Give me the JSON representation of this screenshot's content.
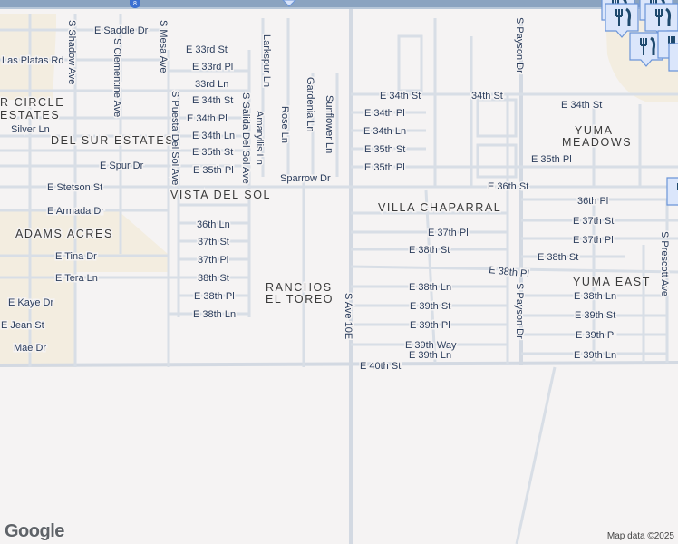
{
  "highway": {
    "shield": "8"
  },
  "neighborhoods": {
    "circle_estates_1": "R CIRCLE",
    "circle_estates_2": "ESTATES",
    "del_sur": "DEL SUR ESTATES",
    "vista": "VISTA DEL SOL",
    "adams": "ADAMS ACRES",
    "ranchos_1": "RANCHOS",
    "ranchos_2": "EL TOREO",
    "villa": "VILLA CHAPARRAL",
    "yuma_meadows_1": "YUMA",
    "yuma_meadows_2": "MEADOWS",
    "yuma_east": "YUMA EAST"
  },
  "streets": {
    "saddle": "E Saddle Dr",
    "las_platas": "Las Platas Rd",
    "shadow": "S Shadow Ave",
    "clementine": "S Clementine Ave",
    "mesa": "S Mesa Ave",
    "e33st": "E 33rd St",
    "e33pl": "E 33rd Pl",
    "ln33": "33rd Ln",
    "e34st_w": "E 34th St",
    "e34pl_w": "E 34th Pl",
    "e34ln_w": "E 34th Ln",
    "e35st_w": "E 35th St",
    "e35pl_w": "E 35th Pl",
    "silver": "Silver Ln",
    "spur": "E Spur Dr",
    "puesta": "S Puesta Del Sol Ave",
    "salida": "S Salida Del Sol Ave",
    "larkspur": "Larkspur Ln",
    "amaryllis": "Amaryllis Ln",
    "rose": "Rose Ln",
    "gardenia": "Gardenia Ln",
    "sunflower": "Sunflower Ln",
    "sparrow": "Sparrow Dr",
    "stetson": "E Stetson St",
    "armada": "E Armada Dr",
    "ln36": "36th Ln",
    "st37": "37th St",
    "pl37": "37th Pl",
    "st38": "38th St",
    "e38pl_w": "E 38th Pl",
    "e38ln_w": "E 38th Ln",
    "tina": "E Tina Dr",
    "tera": "E Tera Ln",
    "kaye": "E Kaye Dr",
    "jean": "E Jean St",
    "mae": "Mae Dr",
    "e34st_c": "E 34th St",
    "e34pl_c": "E 34th Pl",
    "e34ln_c": "E 34th Ln",
    "e35st_c": "E 35th St",
    "e35pl_c": "E 35th Pl",
    "st34": "34th St",
    "payson_n": "S Payson Dr",
    "e34st_e": "E 34th St",
    "e35pl_e": "E 35th Pl",
    "e36st": "E 36th St",
    "pl36": "36th Pl",
    "e37st": "E 37th St",
    "e37pl_c": "E 37th Pl",
    "e37pl_e": "E 37th Pl",
    "e38st_c": "E 38th St",
    "e38st_e": "E 38th St",
    "e38pl": "E 38th Pl",
    "e38ln_c": "E 38th Ln",
    "e38ln_e": "E 38th Ln",
    "e39st_c": "E 39th St",
    "e39st_e": "E 39th St",
    "e39pl_c": "E 39th Pl",
    "e39pl_e": "E 39th Pl",
    "e39way": "E 39th Way",
    "e39ln_c": "E 39th Ln",
    "e39ln_e": "E 39th Ln",
    "e40st": "E 40th St",
    "ave10e": "S Ave 10E",
    "payson_s": "S Payson Dr",
    "prescott": "S Prescott Ave"
  },
  "attribution": {
    "logo": "Google",
    "credit": "Map data ©2025"
  },
  "colors": {
    "road": "#d8dee6",
    "highway": "#8aa3c0",
    "park": "#f3ede0",
    "pin": "#dbe6fb",
    "pin_icon": "#1f4a6e"
  }
}
